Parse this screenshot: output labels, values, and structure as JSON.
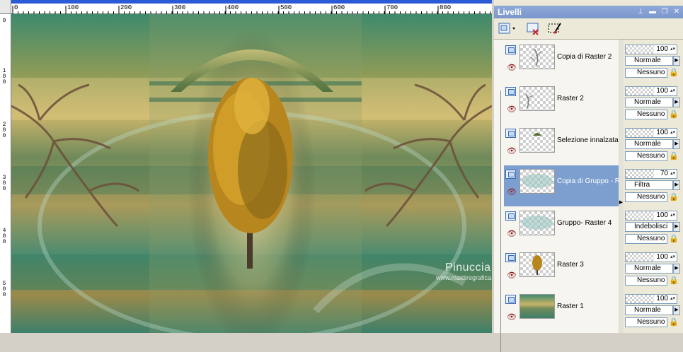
{
  "ruler": {
    "top_labels": [
      "100",
      "200",
      "300",
      "400",
      "500",
      "600",
      "700",
      "800"
    ],
    "left_labels": [
      "1\n0\n0",
      "2\n0\n0",
      "3\n0\n0",
      "4\n0\n0",
      "5\n0\n0"
    ]
  },
  "canvas": {
    "watermark_line1": "Pinuccia",
    "watermark_line2": "www.maidiregrafica.eu"
  },
  "panel": {
    "title": "Livelli",
    "title_buttons": [
      "pin-icon",
      "close-icon",
      "restore-icon",
      "close-x-icon"
    ]
  },
  "layers": [
    {
      "name": "Copia di Raster 2",
      "opacity": "100",
      "blend": "Normale",
      "mask": "Nessuno",
      "selected": false
    },
    {
      "name": "Raster 2",
      "opacity": "100",
      "blend": "Normale",
      "mask": "Nessuno",
      "selected": false
    },
    {
      "name": "Selezione innalzata",
      "opacity": "100",
      "blend": "Normale",
      "mask": "Nessuno",
      "selected": false
    },
    {
      "name": "Copia di Gruppo - R",
      "opacity": "70",
      "blend": "Filtra",
      "mask": "Nessuno",
      "selected": true
    },
    {
      "name": "Gruppo- Raster 4",
      "opacity": "100",
      "blend": "Indebolisci",
      "mask": "Nessuno",
      "selected": false
    },
    {
      "name": "Raster 3",
      "opacity": "100",
      "blend": "Normale",
      "mask": "Nessuno",
      "selected": false
    },
    {
      "name": "Raster 1",
      "opacity": "100",
      "blend": "Normale",
      "mask": "Nessuno",
      "selected": false
    }
  ],
  "colors": {
    "selected_row": "#7c9fcf",
    "title_bar": "#7b97cc"
  }
}
